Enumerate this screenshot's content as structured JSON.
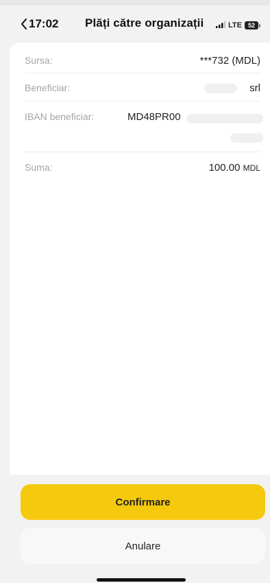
{
  "status": {
    "time": "17:02",
    "network": "LTE",
    "battery": "52"
  },
  "header": {
    "title": "Plăți către organizații"
  },
  "details": {
    "source_label": "Sursa:",
    "source_value": "***732 (MDL)",
    "beneficiary_label": "Beneficiar:",
    "beneficiary_value": "srl",
    "iban_label": "IBAN beneficiar:",
    "iban_value": "MD48PR00",
    "amount_label": "Suma:",
    "amount_value": "100.00",
    "amount_currency": "MDL"
  },
  "actions": {
    "confirm_label": "Confirmare",
    "cancel_label": "Anulare"
  },
  "colors": {
    "accent": "#f5c90e",
    "background": "#f2f2f2",
    "card": "#ffffff"
  }
}
